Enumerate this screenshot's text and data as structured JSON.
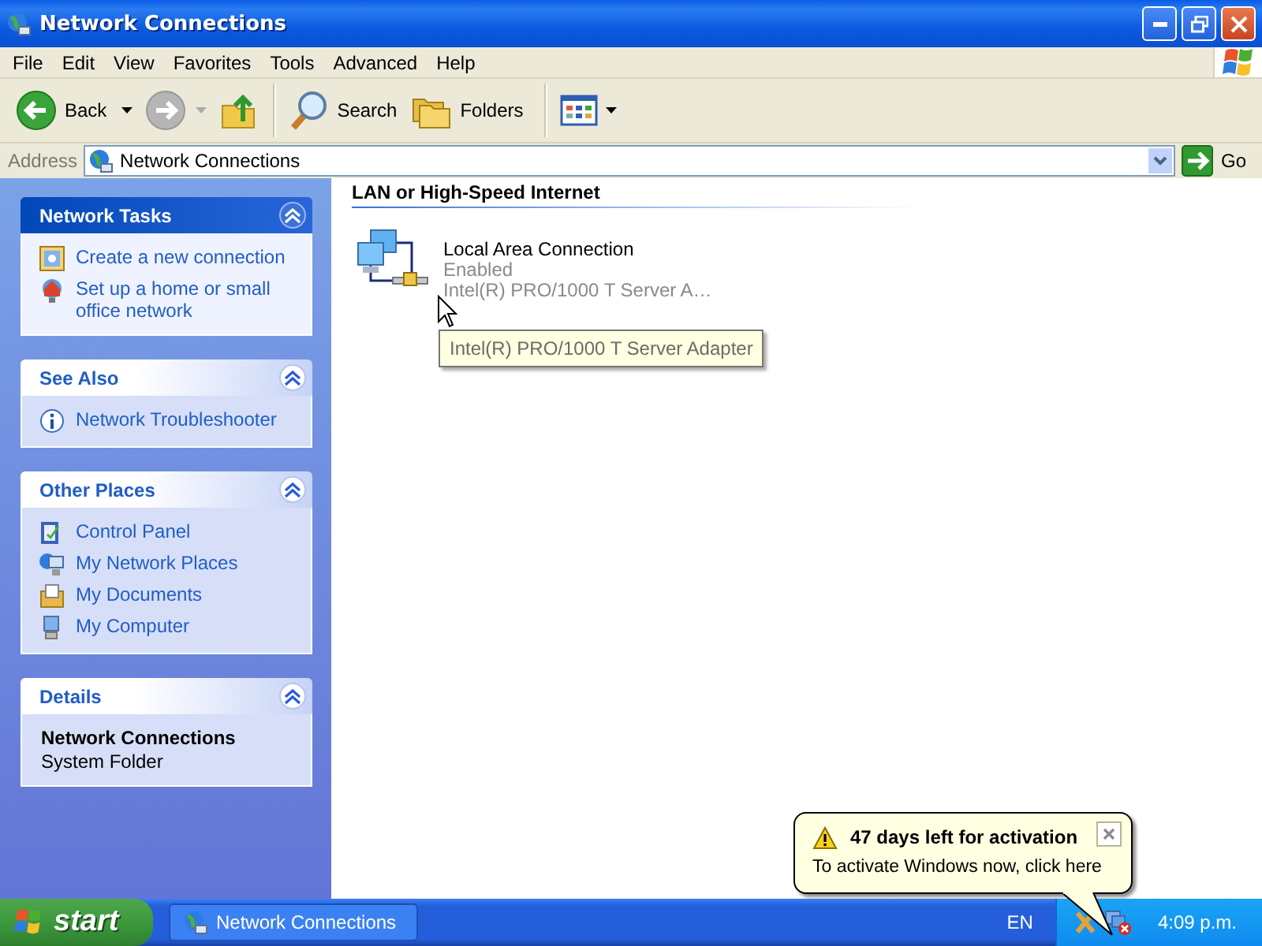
{
  "window": {
    "title": "Network Connections"
  },
  "menu": [
    "File",
    "Edit",
    "View",
    "Favorites",
    "Tools",
    "Advanced",
    "Help"
  ],
  "toolbar": [
    {
      "kind": "back",
      "label": "Back",
      "disabled": false
    },
    {
      "kind": "forward",
      "disabled": true
    },
    {
      "kind": "up"
    },
    {
      "kind": "search",
      "label": "Search"
    },
    {
      "kind": "folders",
      "label": "Folders"
    },
    {
      "kind": "views"
    }
  ],
  "address": {
    "label": "Address",
    "value": "Network Connections",
    "go": "Go"
  },
  "task_panes": [
    {
      "kind": "special",
      "title": "Network Tasks",
      "expanded": true,
      "items": [
        {
          "kind": "new-connection",
          "label": "Create a new connection"
        },
        {
          "kind": "home-network",
          "label": "Set up a home or small office network"
        }
      ]
    },
    {
      "kind": "links",
      "title": "See Also",
      "expanded": true,
      "items": [
        {
          "kind": "info",
          "label": "Network Troubleshooter"
        }
      ]
    },
    {
      "kind": "links",
      "title": "Other Places",
      "expanded": true,
      "items": [
        {
          "kind": "control-panel",
          "label": "Control Panel"
        },
        {
          "kind": "network-places",
          "label": "My Network Places"
        },
        {
          "kind": "documents",
          "label": "My Documents"
        },
        {
          "kind": "computer",
          "label": "My Computer"
        }
      ]
    },
    {
      "kind": "details",
      "title": "Details",
      "expanded": true,
      "name": "Network Connections",
      "subtitle": "System Folder"
    }
  ],
  "section": {
    "title": "LAN or High-Speed Internet"
  },
  "connections": [
    {
      "name": "Local Area Connection",
      "status": "Enabled",
      "device": "Intel(R) PRO/1000 T Server A…"
    }
  ],
  "tooltip": "Intel(R) PRO/1000 T Server Adapter",
  "balloon": {
    "title": "47 days left for activation",
    "text": "To activate Windows now, click here"
  },
  "taskbar": {
    "start": "start",
    "tasks": [
      {
        "label": "Network Connections",
        "selected": false
      }
    ],
    "language": "EN",
    "clock": "4:09 p.m."
  }
}
